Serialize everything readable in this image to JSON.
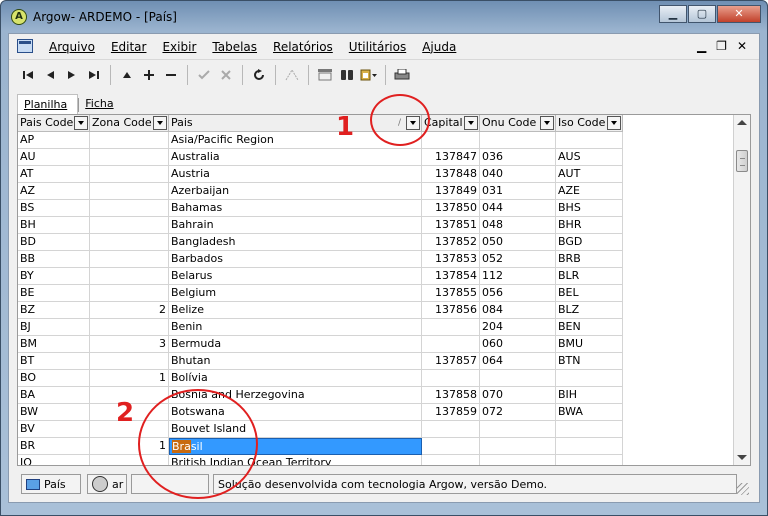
{
  "window": {
    "title": "Argow- ARDEMO - [País]",
    "app_icon_letter": "A"
  },
  "menu": [
    "Arquivo",
    "Editar",
    "Exibir",
    "Tabelas",
    "Relatórios",
    "Utilitários",
    "Ajuda"
  ],
  "mdi_buttons": {
    "minimize": "▁",
    "restore": "❐",
    "close": "✕"
  },
  "toolbar_icons": [
    "first-record-icon",
    "prior-record-icon",
    "next-record-icon",
    "last-record-icon",
    "insert-record-icon",
    "append-record-icon",
    "delete-record-icon",
    "post-record-icon",
    "cancel-record-icon",
    "refresh-icon",
    "filter-icon",
    "grid-report-icon",
    "binoculars-icon",
    "clipboard-icon",
    "print-icon"
  ],
  "tabs": [
    {
      "label": "Planilha",
      "active": true
    },
    {
      "label": "Ficha",
      "active": false
    }
  ],
  "grid": {
    "columns": [
      "Pais Code",
      "Zona Code",
      "Pais",
      "Capital",
      "Onu Code",
      "Iso Code"
    ],
    "sort_indicator": "/",
    "rows": [
      [
        "AP",
        "",
        "Asia/Pacific Region",
        "",
        "",
        ""
      ],
      [
        "AU",
        "",
        "Australia",
        "137847",
        "036",
        "AUS"
      ],
      [
        "AT",
        "",
        "Austria",
        "137848",
        "040",
        "AUT"
      ],
      [
        "AZ",
        "",
        "Azerbaijan",
        "137849",
        "031",
        "AZE"
      ],
      [
        "BS",
        "",
        "Bahamas",
        "137850",
        "044",
        "BHS"
      ],
      [
        "BH",
        "",
        "Bahrain",
        "137851",
        "048",
        "BHR"
      ],
      [
        "BD",
        "",
        "Bangladesh",
        "137852",
        "050",
        "BGD"
      ],
      [
        "BB",
        "",
        "Barbados",
        "137853",
        "052",
        "BRB"
      ],
      [
        "BY",
        "",
        "Belarus",
        "137854",
        "112",
        "BLR"
      ],
      [
        "BE",
        "",
        "Belgium",
        "137855",
        "056",
        "BEL"
      ],
      [
        "BZ",
        "2",
        "Belize",
        "137856",
        "084",
        "BLZ"
      ],
      [
        "BJ",
        "",
        "Benin",
        "",
        "204",
        "BEN"
      ],
      [
        "BM",
        "3",
        "Bermuda",
        "",
        "060",
        "BMU"
      ],
      [
        "BT",
        "",
        "Bhutan",
        "137857",
        "064",
        "BTN"
      ],
      [
        "BO",
        "1",
        "Bolívia",
        "",
        "",
        ""
      ],
      [
        "BA",
        "",
        "Bosnia and Herzegovina",
        "137858",
        "070",
        "BIH"
      ],
      [
        "BW",
        "",
        "Botswana",
        "137859",
        "072",
        "BWA"
      ],
      [
        "BV",
        "",
        "Bouvet Island",
        "",
        "",
        ""
      ],
      [
        "BR",
        "1",
        "Brasil",
        "",
        "",
        ""
      ],
      [
        "IO",
        "",
        "British Indian Ocean Territory",
        "",
        "",
        ""
      ]
    ],
    "selected_row": 18,
    "selected_match": "Bra",
    "selected_rest": "sil"
  },
  "status": {
    "tab_label": "País",
    "user_label": "ar",
    "message": "Solução desenvolvida com tecnologia Argow, versão Demo."
  },
  "annotations": [
    "1",
    "2"
  ],
  "colors": {
    "selection": "#3399ff",
    "match_highlight": "#c86a10",
    "annotation": "#e02020"
  }
}
